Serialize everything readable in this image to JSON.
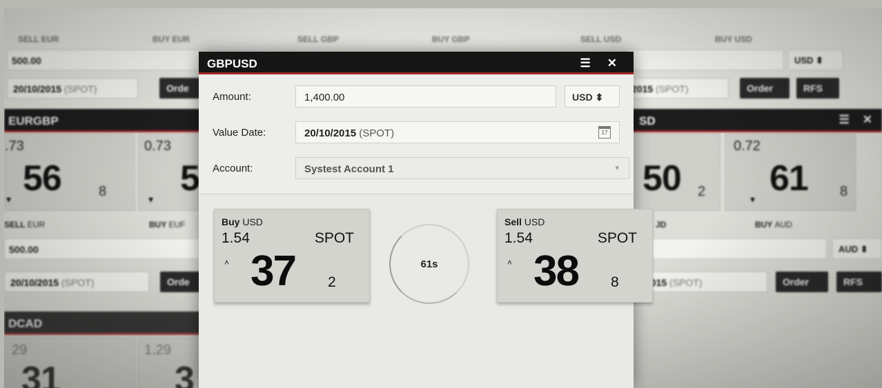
{
  "background": {
    "top_row": [
      {
        "sell_label": "SELL EUR",
        "buy_label": "BUY EUR"
      },
      {
        "sell_label": "SELL GBP",
        "buy_label": "BUY GBP"
      },
      {
        "sell_label": "SELL USD",
        "buy_label": "BUY USD"
      }
    ],
    "top_left_amount": "500.00",
    "top_left_date": "20/10/2015",
    "top_left_tenor": "(SPOT)",
    "top_left_order": "Orde",
    "top_right_currency": "USD ⬍",
    "top_right_date": "2015",
    "top_right_tenor": "(SPOT)",
    "top_right_order": "Order",
    "top_right_rfs": "RFS",
    "eurgbp": {
      "title": "EURGBP",
      "sell_bigfig": ".73",
      "sell_pips": "56",
      "sell_frac": "8",
      "buy_bigfig": "0.73",
      "buy_pips": "5",
      "sell_label_bold": "SELL",
      "sell_label_ccy": "EUR",
      "buy_label_bold": "BUY",
      "buy_label_ccy": "EUF",
      "amount": "500.00",
      "date": "20/10/2015",
      "tenor": "(SPOT)",
      "order": "Orde"
    },
    "right_tile": {
      "title": "SD",
      "sell_pips": "50",
      "sell_frac": "2",
      "buy_bigfig": "0.72",
      "buy_pips": "61",
      "buy_frac": "8",
      "sell_label": "JD",
      "buy_label_bold": "BUY",
      "buy_label_ccy": "AUD",
      "currency": "AUD ⬍",
      "date": "2015",
      "tenor": "(SPOT)",
      "order": "Order",
      "rfs": "RFS"
    },
    "bottom_left": {
      "title": "DCAD",
      "bigfig_a": "29",
      "bigfig_b": "1.29",
      "pips_a": "31",
      "pips_b": "3"
    }
  },
  "dialog": {
    "title": "GBPUSD",
    "menu_icon": "hamburger-icon",
    "close_icon": "close-icon",
    "amount_label": "Amount:",
    "amount_value": "1,400.00",
    "currency": "USD ⬍",
    "value_date_label": "Value Date:",
    "value_date": "20/10/2015",
    "value_date_tenor": "(SPOT)",
    "calendar_day": "17",
    "account_label": "Account:",
    "account_value": "Systest Account 1",
    "buy": {
      "side": "Buy",
      "ccy": "USD",
      "bigfig": "1.54",
      "tenor": "SPOT",
      "pips": "37",
      "frac": "2",
      "arrow": "˄"
    },
    "sell": {
      "side": "Sell",
      "ccy": "USD",
      "bigfig": "1.54",
      "tenor": "SPOT",
      "pips": "38",
      "frac": "8",
      "arrow": "˄"
    },
    "timer": "61s"
  }
}
